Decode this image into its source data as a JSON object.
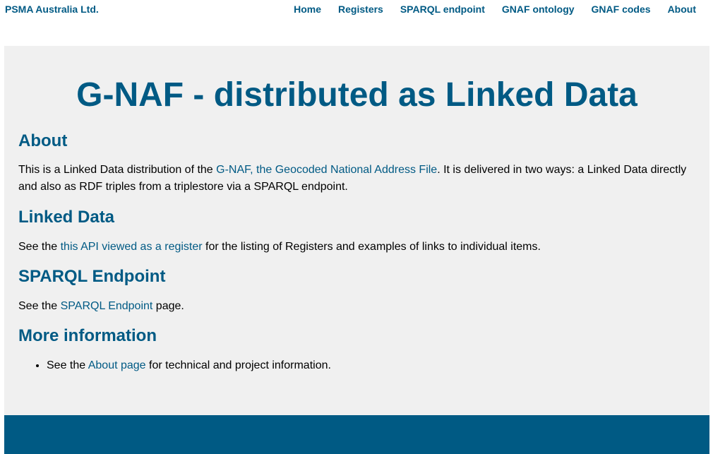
{
  "header": {
    "brand": "PSMA Australia Ltd.",
    "nav": [
      {
        "label": "Home"
      },
      {
        "label": "Registers"
      },
      {
        "label": "SPARQL endpoint"
      },
      {
        "label": "GNAF ontology"
      },
      {
        "label": "GNAF codes"
      },
      {
        "label": "About"
      }
    ]
  },
  "main": {
    "title": "G-NAF - distributed as Linked Data",
    "sections": {
      "about": {
        "heading": "About",
        "text_before": "This is a Linked Data distribution of the ",
        "link": "G-NAF, the Geocoded National Address File",
        "text_after": ". It is delivered in two ways: a Linked Data directly and also as RDF triples from a triplestore via a SPARQL endpoint."
      },
      "linked_data": {
        "heading": "Linked Data",
        "text_before": "See the ",
        "link": "this API viewed as a register",
        "text_after": " for the listing of Registers and examples of links to individual items."
      },
      "sparql": {
        "heading": "SPARQL Endpoint",
        "text_before": "See the ",
        "link": "SPARQL Endpoint",
        "text_after": " page."
      },
      "more_info": {
        "heading": "More information",
        "items": [
          {
            "text_before": "See the ",
            "link": "About page",
            "text_after": " for technical and project information."
          }
        ]
      }
    }
  },
  "colors": {
    "brand": "#005a84",
    "panel_bg": "#f0f0f0",
    "footer_bg": "#005a84"
  }
}
